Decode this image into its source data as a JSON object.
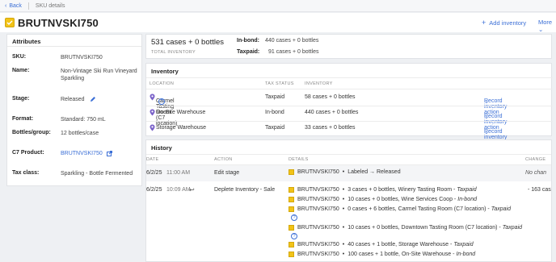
{
  "topbar": {
    "back_label": "Back",
    "crumb": "SKU details"
  },
  "header": {
    "title": "BRUTNVSKI750",
    "add_inventory": "Add inventory",
    "more": "More"
  },
  "attributes": {
    "heading": "Attributes",
    "rows": [
      {
        "key": "SKU:",
        "value": "BRUTNVSKI750"
      },
      {
        "key": "Name:",
        "value": "Non-Vintage Ski Run Vineyard Sparkling"
      },
      {
        "key": "Stage:",
        "value": "Released"
      },
      {
        "key": "Format:",
        "value": "Standard: 750 mL"
      },
      {
        "key": "Bottles/group:",
        "value": "12 bottles/case"
      },
      {
        "key": "C7 Product:",
        "value": "BRUTNVSKI750"
      },
      {
        "key": "Tax class:",
        "value": "Sparkling - Bottle Fermented"
      }
    ]
  },
  "summary": {
    "total": "531 cases + 0 bottles",
    "total_label": "TOTAL INVENTORY",
    "inbond_label": "In-bond:",
    "inbond_value": "440 cases + 0 bottles",
    "taxpaid_label": "Taxpaid:",
    "taxpaid_value": "91 cases + 0 bottles"
  },
  "inventory": {
    "heading": "Inventory",
    "columns": [
      "LOCATION",
      "TAX STATUS",
      "INVENTORY"
    ],
    "action_label": "Record inventory action",
    "rows": [
      {
        "location": "Carmel Tasting Room (C7 location)",
        "tax": "Taxpaid",
        "qty": "58 cases + 0 bottles",
        "help": "?"
      },
      {
        "location": "On-Site Warehouse",
        "tax": "In-bond",
        "qty": "440 cases + 0 bottles"
      },
      {
        "location": "Storage Warehouse",
        "tax": "Taxpaid",
        "qty": "33 cases + 0 bottles"
      }
    ]
  },
  "history": {
    "heading": "History",
    "columns": [
      "DATE",
      "ACTION",
      "DETAILS",
      "CHANGE"
    ],
    "entries": [
      {
        "date": "6/2/25",
        "time": "11:00 AM",
        "action": "Edit stage",
        "change": "No chan",
        "details": [
          {
            "sku": "BRUTNVSKI750",
            "text": "Labeled → Released",
            "status": ""
          }
        ]
      },
      {
        "date": "6/2/25",
        "time": "10:09 AM",
        "action": "Deplete Inventory - Sale",
        "change": "- 163 cas",
        "details": [
          {
            "sku": "BRUTNVSKI750",
            "text": "3 cases + 0 bottles, Winery Tasting Room - ",
            "status": "Taxpaid"
          },
          {
            "sku": "BRUTNVSKI750",
            "text": "10 cases + 0 bottles, Wine Services Coop - ",
            "status": "In-bond"
          },
          {
            "sku": "BRUTNVSKI750",
            "text": "0 cases + 6 bottles, Carmel Tasting Room (C7 location) - ",
            "status": "Taxpaid"
          },
          {
            "sku": "BRUTNVSKI750",
            "text": "10 cases + 0 bottles, Downtown Tasting Room (C7 location) - ",
            "status": "Taxpaid"
          },
          {
            "sku": "BRUTNVSKI750",
            "text": "40 cases + 1 bottle, Storage Warehouse - ",
            "status": "Taxpaid"
          },
          {
            "sku": "BRUTNVSKI750",
            "text": "100 cases + 1 bottle, On-Site Warehouse - ",
            "status": "In-bond"
          }
        ]
      }
    ]
  },
  "colors": {
    "accent": "#3b6fd6",
    "sku_icon": "#f2c318"
  }
}
